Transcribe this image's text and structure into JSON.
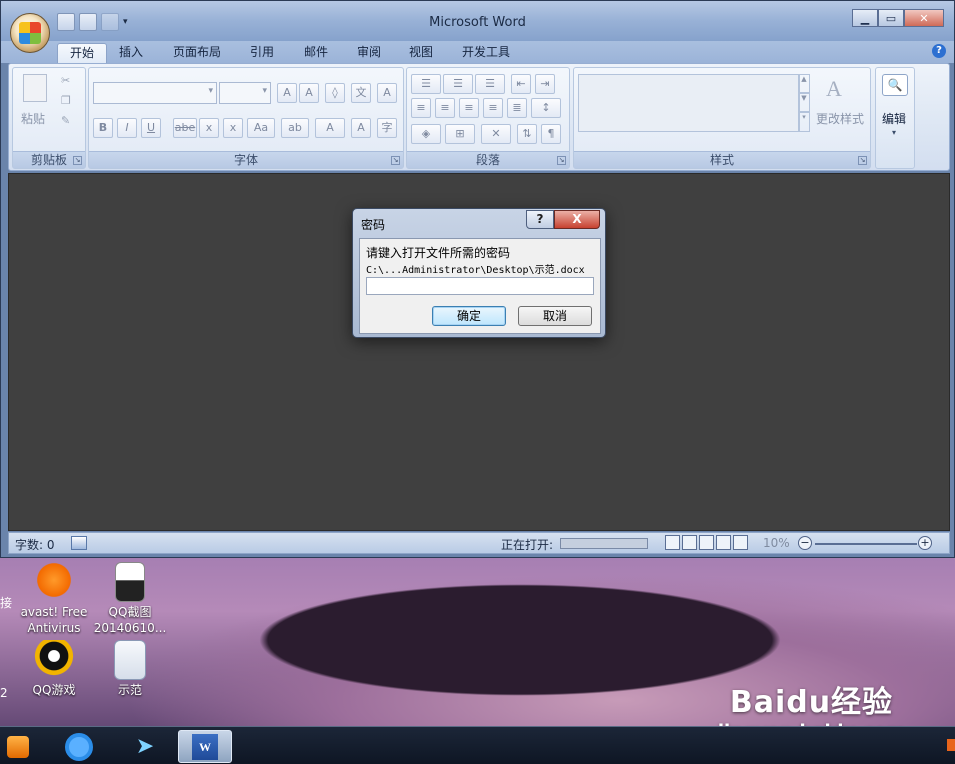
{
  "window": {
    "title": "Microsoft Word"
  },
  "tabs": [
    "开始",
    "插入",
    "页面布局",
    "引用",
    "邮件",
    "审阅",
    "视图",
    "开发工具"
  ],
  "ribbon": {
    "clipboard": {
      "label": "剪贴板",
      "paste": "粘贴"
    },
    "font": {
      "label": "字体"
    },
    "paragraph": {
      "label": "段落"
    },
    "styles": {
      "label": "样式",
      "change_styles": "更改样式"
    },
    "editing": {
      "label": "编辑"
    }
  },
  "status": {
    "word_count": "字数: 0",
    "opening": "正在打开:",
    "zoom": "10%"
  },
  "dialog": {
    "title": "密码",
    "help": "?",
    "close": "X",
    "prompt": "请键入打开文件所需的密码",
    "path": "C:\\...Administrator\\Desktop\\示范.docx",
    "password_value": "",
    "ok": "确定",
    "cancel": "取消"
  },
  "desktop": {
    "icons": [
      {
        "label": "avast! Free Antivirus"
      },
      {
        "label": "QQ截图 20140610..."
      },
      {
        "label": "QQ游戏"
      },
      {
        "label": "示范"
      }
    ],
    "partial_left_1": "接",
    "partial_left_2": "2"
  },
  "watermark": {
    "brand": "Baidu经验",
    "domain": "jingyan.baidu.com"
  },
  "colors": {
    "accent": "#3c7fb1",
    "close_red": "#c7412f",
    "doc_bg": "#404040"
  }
}
